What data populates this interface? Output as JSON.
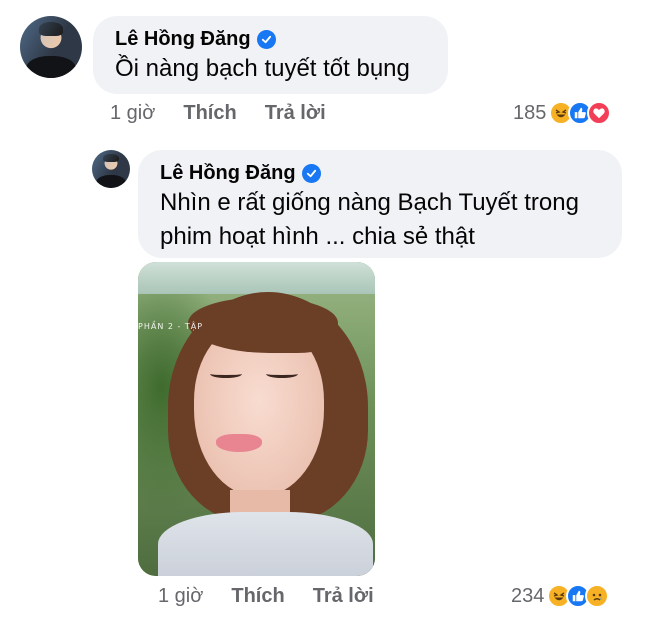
{
  "comments": [
    {
      "author": "Lê Hồng Đăng",
      "verified": true,
      "text": "Ồi nàng bạch tuyết tốt bụng",
      "time": "1 giờ",
      "like_label": "Thích",
      "reply_label": "Trả lời",
      "reaction_count": "185",
      "reactions": [
        "haha",
        "like",
        "love"
      ]
    },
    {
      "author": "Lê Hồng Đăng",
      "verified": true,
      "text_line1": "Nhìn e rất giống nàng Bạch Tuyết trong",
      "text_line2": "phim hoạt hình ... chia sẻ thật",
      "attachment_caption": "PHẦN 2 - TẬP",
      "time": "1 giờ",
      "like_label": "Thích",
      "reply_label": "Trả lời",
      "reaction_count": "234",
      "reactions": [
        "haha",
        "like",
        "sad"
      ]
    }
  ],
  "colors": {
    "bubble": "#f0f2f5",
    "verified_badge": "#1877f2",
    "meta_text": "#65676b"
  }
}
